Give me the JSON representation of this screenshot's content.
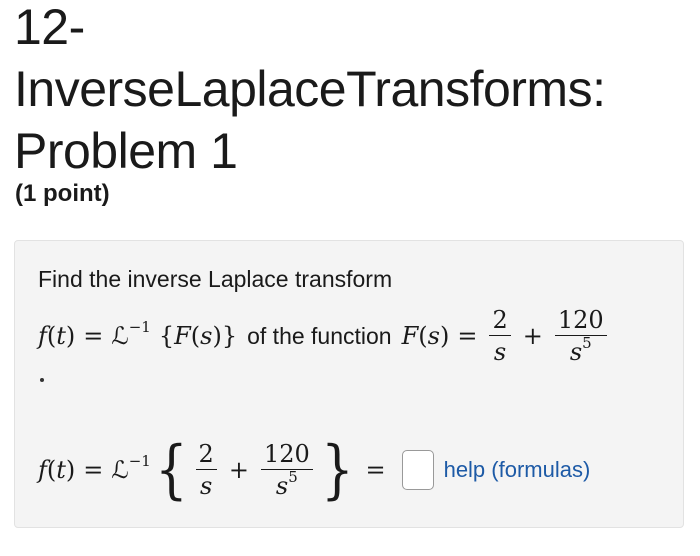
{
  "header": {
    "title_line1": "12-",
    "title_line2": "InverseLaplaceTransforms:",
    "title_line3": "Problem 1",
    "points": "(1 point)"
  },
  "problem": {
    "intro": "Find the inverse Laplace transform",
    "middle_text": "of the function",
    "help_link": "help (formulas)"
  },
  "math": {
    "f": "f",
    "t": "t",
    "F": "F",
    "s": "s",
    "L": "ℒ",
    "inv": "−1",
    "num1": "2",
    "num2": "120",
    "exp": "5"
  },
  "answer": {
    "value": ""
  }
}
